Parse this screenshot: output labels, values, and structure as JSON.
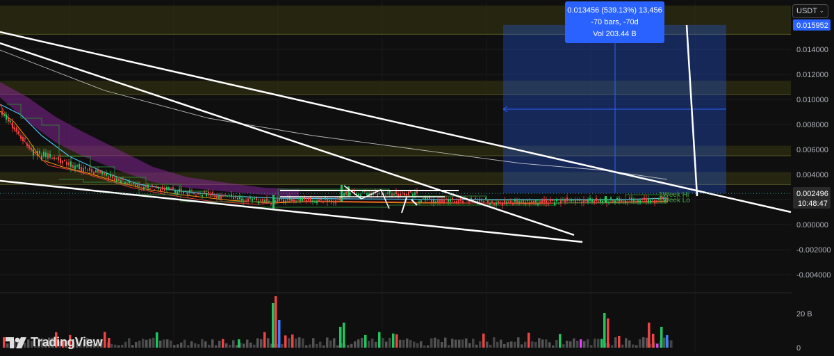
{
  "header": {
    "currency_label": "USDT",
    "currency_chevron": "chevron-down-icon"
  },
  "tooltip": {
    "line1": "0.013456 (539.13%) 13,456",
    "line2": "-70 bars, -70d",
    "line3": "Vol 203.44 B"
  },
  "price_scale": {
    "ticks": [
      "0.014000",
      "0.012000",
      "0.010000",
      "0.008000",
      "0.006000",
      "0.004000",
      "0.000000",
      "-0.002000",
      "-0.004000"
    ],
    "top_badge": "0.015952",
    "current_price": "0.002496",
    "countdown": "10:48:47"
  },
  "volume_scale": {
    "ticks": [
      "20 B",
      "0"
    ]
  },
  "labels": {
    "week_hi": "1Week Hi",
    "week_lo": "1Week Lo"
  },
  "branding": {
    "logo_text": "TradingView"
  },
  "colors": {
    "background": "#0f0f0f",
    "up": "#22c55e",
    "down": "#ef4444",
    "measure": "#2962ff",
    "zone": "#3a3a12",
    "trendline": "#ffffff",
    "ribbon": "#9c27b0"
  },
  "chart_data": {
    "type": "candlestick",
    "title": "",
    "ylim": [
      -0.0054,
      0.0175
    ],
    "price_level": 0.002496,
    "measure_top": 0.015952,
    "horizontal_zones": [
      [
        0.0152,
        0.0175
      ],
      [
        0.0104,
        0.0115
      ],
      [
        0.0055,
        0.0063
      ],
      [
        0.0032,
        0.0042
      ]
    ],
    "week_levels": {
      "hi": 0.0026,
      "lo": 0.0019
    }
  }
}
